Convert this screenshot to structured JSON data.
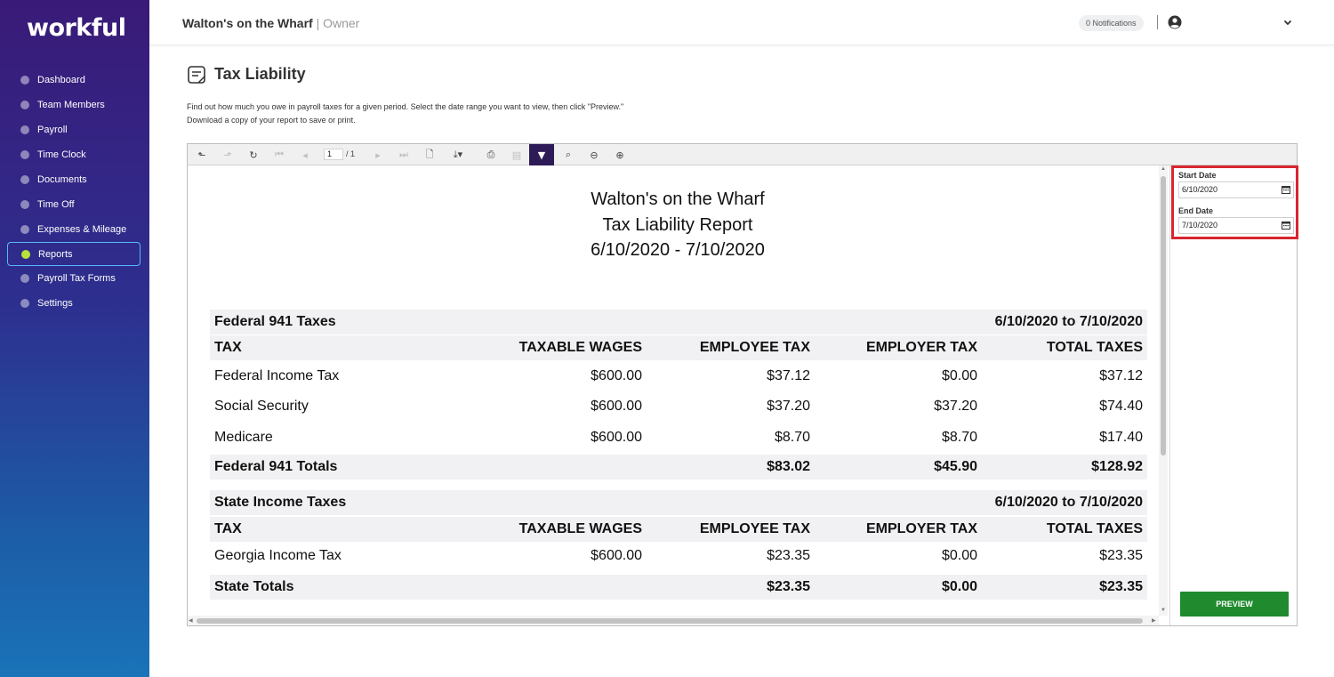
{
  "brand": {
    "logo_text": "workful"
  },
  "sidebar": {
    "items": [
      {
        "label": "Dashboard"
      },
      {
        "label": "Team Members"
      },
      {
        "label": "Payroll"
      },
      {
        "label": "Time Clock"
      },
      {
        "label": "Documents"
      },
      {
        "label": "Time Off"
      },
      {
        "label": "Expenses & Mileage"
      },
      {
        "label": "Reports",
        "active": true
      },
      {
        "label": "Payroll Tax Forms"
      },
      {
        "label": "Settings"
      }
    ]
  },
  "header": {
    "business": "Walton's on the Wharf",
    "role": "| Owner",
    "notifications": "0 Notifications"
  },
  "page": {
    "title": "Tax Liability",
    "description_line1": "Find out how much you owe in payroll taxes for a given period. Select the date range you want to view, then click \"Preview.\"",
    "description_line2": "Download a copy of your report to save or print."
  },
  "toolbar": {
    "page_current": "1",
    "page_total": "/ 1"
  },
  "report": {
    "title_line1": "Walton's on the Wharf",
    "title_line2": "Tax Liability Report",
    "title_line3": "6/10/2020 - 7/10/2020",
    "sections": [
      {
        "name": "Federal 941 Taxes",
        "range": "6/10/2020 to 7/10/2020",
        "headers": [
          "TAX",
          "TAXABLE WAGES",
          "EMPLOYEE TAX",
          "EMPLOYER TAX",
          "TOTAL TAXES"
        ],
        "rows": [
          [
            "Federal Income Tax",
            "$600.00",
            "$37.12",
            "$0.00",
            "$37.12"
          ],
          [
            "Social Security",
            "$600.00",
            "$37.20",
            "$37.20",
            "$74.40"
          ],
          [
            "Medicare",
            "$600.00",
            "$8.70",
            "$8.70",
            "$17.40"
          ]
        ],
        "totals": [
          "Federal 941 Totals",
          "",
          "$83.02",
          "$45.90",
          "$128.92"
        ]
      },
      {
        "name": "State Income Taxes",
        "range": "6/10/2020 to 7/10/2020",
        "headers": [
          "TAX",
          "TAXABLE WAGES",
          "EMPLOYEE TAX",
          "EMPLOYER TAX",
          "TOTAL TAXES"
        ],
        "rows": [
          [
            "Georgia Income Tax",
            "$600.00",
            "$23.35",
            "$0.00",
            "$23.35"
          ]
        ],
        "totals": [
          "State Totals",
          "",
          "$23.35",
          "$0.00",
          "$23.35"
        ]
      }
    ]
  },
  "params": {
    "start_label": "Start Date",
    "start_value": "6/10/2020",
    "end_label": "End Date",
    "end_value": "7/10/2020",
    "preview_label": "PREVIEW"
  },
  "colors": {
    "accent": "#2d1b57",
    "preview": "#1f8b2e",
    "highlight": "#d7262f",
    "active_dot": "#b7e33b"
  }
}
